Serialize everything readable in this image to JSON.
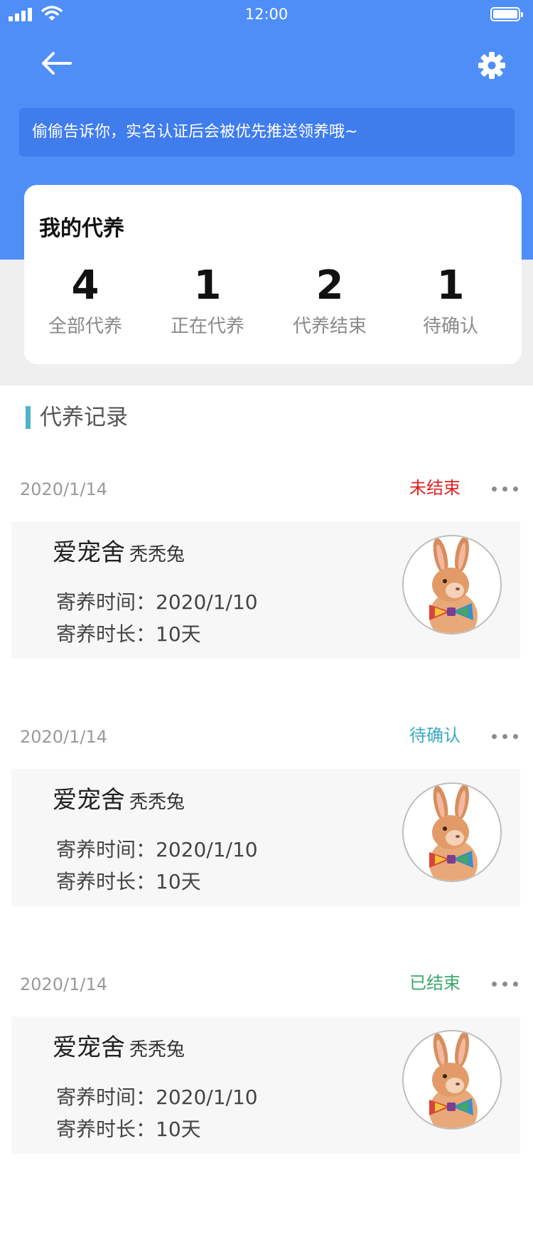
{
  "status_bar": {
    "time": "12:00"
  },
  "notice": {
    "text": "偷偷告诉你，实名认证后会被优先推送领养哦~"
  },
  "stats": {
    "title": "我的代养",
    "items": [
      {
        "value": "4",
        "label": "全部代养"
      },
      {
        "value": "1",
        "label": "正在代养"
      },
      {
        "value": "2",
        "label": "代养结束"
      },
      {
        "value": "1",
        "label": "待确认"
      }
    ]
  },
  "records_section": {
    "title": "代养记录"
  },
  "records": [
    {
      "date": "2020/1/14",
      "status": "未结束",
      "status_color": "#e02020",
      "shop": "爱宠舍",
      "pet": "秃秃兔",
      "time_line": "寄养时间：2020/1/10",
      "duration_line": "寄养时长：10天"
    },
    {
      "date": "2020/1/14",
      "status": "待确认",
      "status_color": "#3aa9c2",
      "shop": "爱宠舍",
      "pet": "秃秃兔",
      "time_line": "寄养时间：2020/1/10",
      "duration_line": "寄养时长：10天"
    },
    {
      "date": "2020/1/14",
      "status": "已结束",
      "status_color": "#3aa86a",
      "shop": "爱宠舍",
      "pet": "秃秃兔",
      "time_line": "寄养时间：2020/1/10",
      "duration_line": "寄养时长：10天"
    }
  ],
  "colors": {
    "header": "#4f8ef7",
    "notice_bg": "#3f7cec",
    "accent_bar": "#4db3c8"
  },
  "icons": {
    "back": "arrow-left-icon",
    "settings": "gear-icon",
    "more": "more-dots-icon",
    "avatar": "rabbit-avatar"
  }
}
